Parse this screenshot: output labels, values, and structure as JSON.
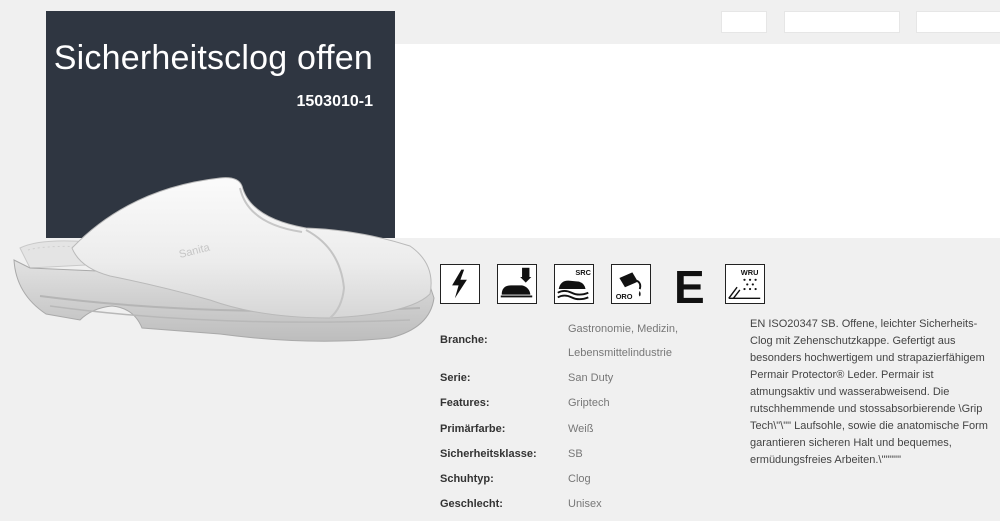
{
  "product": {
    "title": "Sicherheitsclog offen",
    "sku": "1503010-1",
    "brand_mark": "Sanita"
  },
  "icons": [
    {
      "name": "lightning-antistatic-icon"
    },
    {
      "name": "toe-cap-impact-icon"
    },
    {
      "name": "src-slip-resistance-icon",
      "label": "SRC"
    },
    {
      "name": "oro-oil-resistance-icon",
      "label": "ORO"
    },
    {
      "name": "energy-absorption-e-icon",
      "label": "E"
    },
    {
      "name": "wru-water-resistance-icon",
      "label": "WRU"
    }
  ],
  "specs": [
    {
      "label": "Branche:",
      "value_line1": "Gastronomie, Medizin,",
      "value_line2": "Lebensmittelindustrie"
    },
    {
      "label": "Serie:",
      "value": "San Duty"
    },
    {
      "label": "Features:",
      "value": "Griptech"
    },
    {
      "label": "Primärfarbe:",
      "value": "Weiß"
    },
    {
      "label": "Sicherheitsklasse:",
      "value": "SB"
    },
    {
      "label": "Schuhtyp:",
      "value": "Clog"
    },
    {
      "label": "Geschlecht:",
      "value": "Unisex"
    }
  ],
  "description": "EN ISO20347 SB. Offene, leichter Sicherheits-Clog mit Zehenschutzkappe. Gefertigt aus besonders hochwertigem und strapazierfähigem Permair Protector® Leder. Permair ist atmungsaktiv und wasserabweisend. Die rutschhemmende und stossabsorbierende \\Grip Tech\\\"\\\"\" Laufsohle, sowie die anatomische Form garantieren sicheren Halt und bequemes, ermüdungsfreies Arbeiten.\\\"\"\"\"\""
}
